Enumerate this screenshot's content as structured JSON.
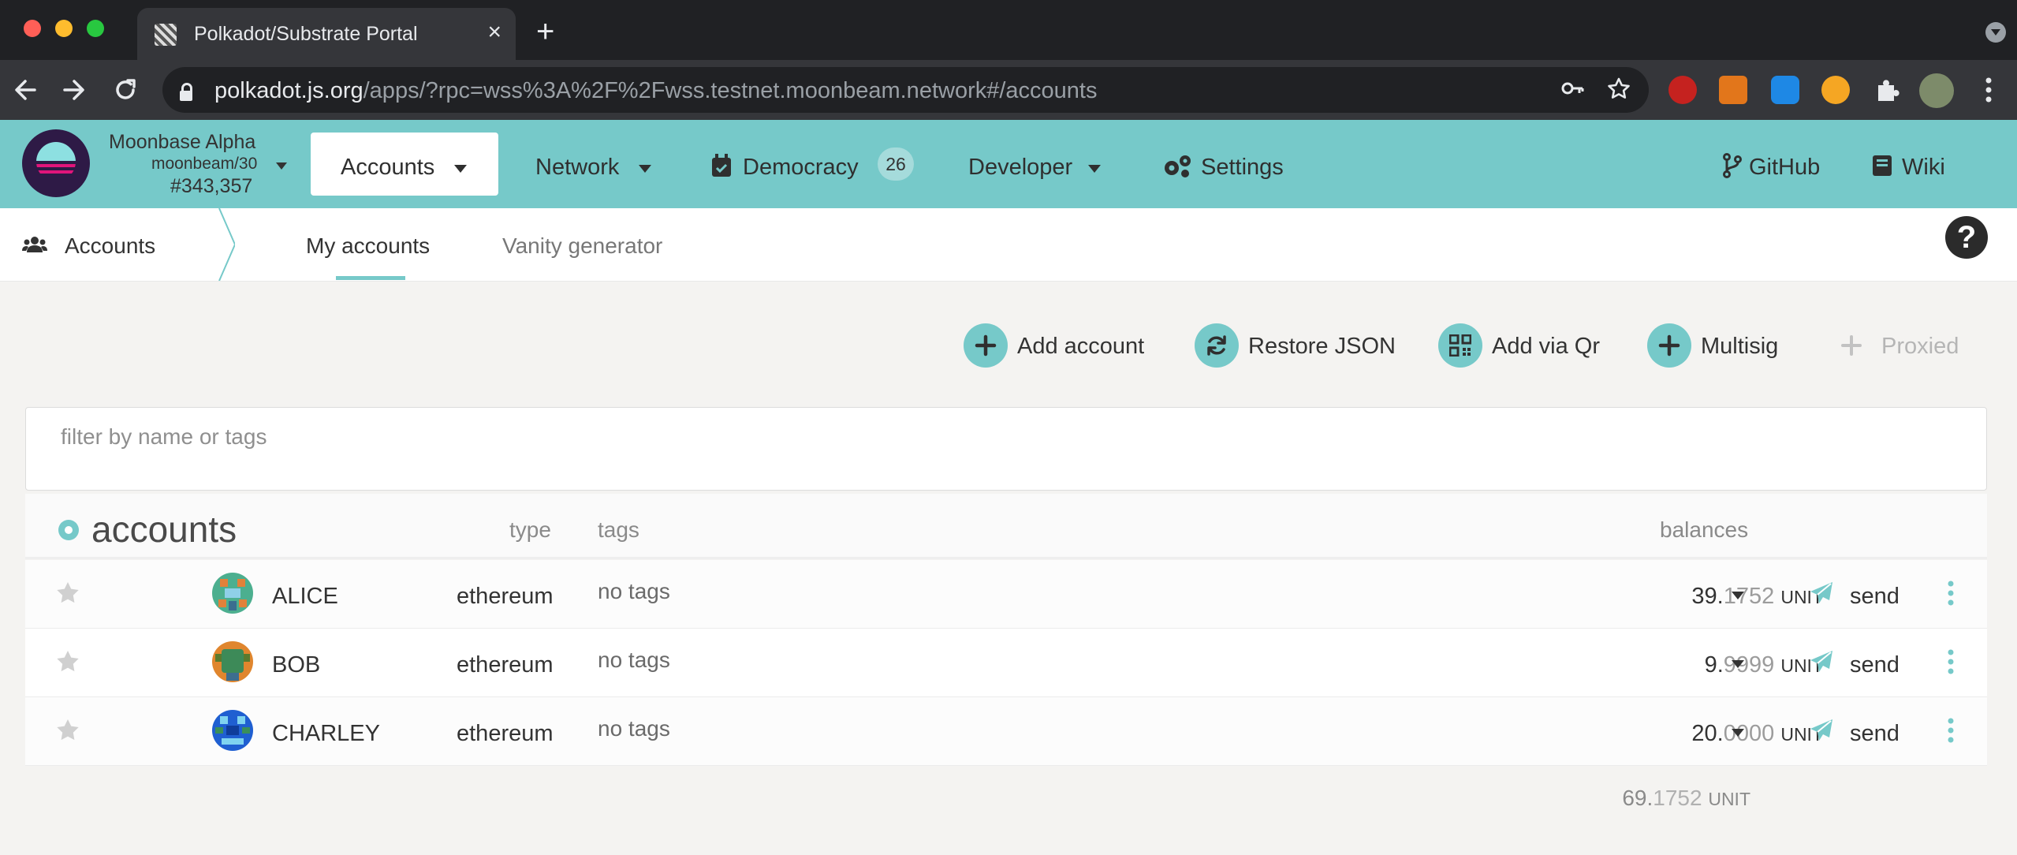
{
  "browser": {
    "tab_title": "Polkadot/Substrate Portal",
    "url_host": "polkadot.js.org",
    "url_path": "/apps/?rpc=wss%3A%2F%2Fwss.testnet.moonbeam.network#/accounts"
  },
  "header": {
    "chain_name": "Moonbase Alpha",
    "chain_spec": "moonbeam/30",
    "block": "#343,357",
    "menu": {
      "accounts": "Accounts",
      "network": "Network",
      "democracy": "Democracy",
      "democracy_count": "26",
      "developer": "Developer",
      "settings": "Settings",
      "github": "GitHub",
      "wiki": "Wiki"
    }
  },
  "subnav": {
    "section": "Accounts",
    "tabs": [
      "My accounts",
      "Vanity generator"
    ],
    "active_tab": "My accounts"
  },
  "actions": {
    "add_account": "Add account",
    "restore_json": "Restore JSON",
    "add_via_qr": "Add via Qr",
    "multisig": "Multisig",
    "proxied": "Proxied"
  },
  "filter": {
    "placeholder": "filter by name or tags",
    "value": ""
  },
  "table": {
    "title": "accounts",
    "col_type": "type",
    "col_tags": "tags",
    "col_balances": "balances",
    "rows": [
      {
        "name": "ALICE",
        "type": "ethereum",
        "tags": "no tags",
        "balance_int": "39.",
        "balance_dec": "1752",
        "unit": "UNIT",
        "action": "send"
      },
      {
        "name": "BOB",
        "type": "ethereum",
        "tags": "no tags",
        "balance_int": "9.",
        "balance_dec": "9999",
        "unit": "UNIT",
        "action": "send"
      },
      {
        "name": "CHARLEY",
        "type": "ethereum",
        "tags": "no tags",
        "balance_int": "20.",
        "balance_dec": "0000",
        "unit": "UNIT",
        "action": "send"
      }
    ],
    "total_int": "69.",
    "total_dec": "1752",
    "total_unit": "UNIT"
  },
  "colors": {
    "accent": "#76c9c9",
    "background": "#f4f3f1"
  }
}
